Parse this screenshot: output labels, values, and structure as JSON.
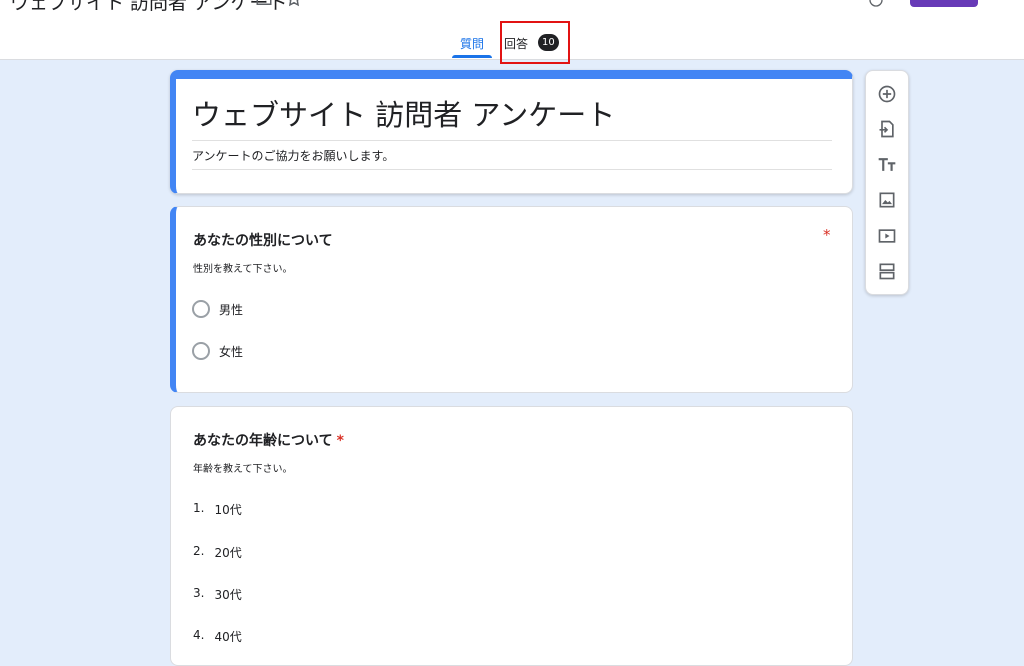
{
  "header": {
    "doc_title": "ウェブサイト 訪問者 アンケート",
    "tabs": [
      {
        "label": "質問",
        "active": true
      },
      {
        "label": "回答",
        "badge": "10",
        "active": false
      }
    ]
  },
  "form": {
    "title": "ウェブサイト 訪問者 アンケート",
    "description": "アンケートのご協力をお願いします。"
  },
  "questions": [
    {
      "title": "あなたの性別について",
      "required_mark": "*",
      "help": "性別を教えて下さい。",
      "options": [
        "男性",
        "女性"
      ]
    },
    {
      "title": "あなたの年齢について",
      "required_mark": "*",
      "help": "年齢を教えて下さい。",
      "options": [
        {
          "num": "1.",
          "label": "10代"
        },
        {
          "num": "2.",
          "label": "20代"
        },
        {
          "num": "3.",
          "label": "30代"
        },
        {
          "num": "4.",
          "label": "40代"
        }
      ]
    }
  ],
  "toolbar": {
    "tools": [
      "add-question-icon",
      "import-questions-icon",
      "add-title-icon",
      "add-image-icon",
      "add-video-icon",
      "add-section-icon"
    ]
  },
  "colors": {
    "accent": "#1a73e8",
    "form_accent": "#4285f4",
    "required": "#d93025",
    "highlight": "#e21313",
    "send_button": "#673ab7",
    "background": "#e3edfb"
  }
}
